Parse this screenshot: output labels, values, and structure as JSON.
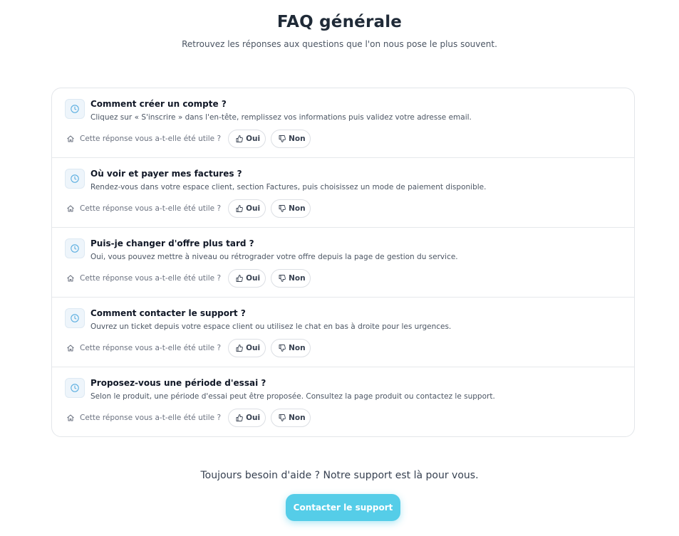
{
  "header": {
    "title": "FAQ générale",
    "subtitle": "Retrouvez les réponses aux questions que l'on nous pose le plus souvent."
  },
  "faq": {
    "feedback_label": "Cette réponse vous a-t-elle été utile ?",
    "yes_label": "Oui",
    "no_label": "Non",
    "items": [
      {
        "question": "Comment créer un compte ?",
        "answer": "Cliquez sur « S'inscrire » dans l'en-tête, remplissez vos informations puis validez votre adresse email."
      },
      {
        "question": "Où voir et payer mes factures ?",
        "answer": "Rendez-vous dans votre espace client, section Factures, puis choisissez un mode de paiement disponible."
      },
      {
        "question": "Puis-je changer d'offre plus tard ?",
        "answer": "Oui, vous pouvez mettre à niveau ou rétrograder votre offre depuis la page de gestion du service."
      },
      {
        "question": "Comment contacter le support ?",
        "answer": "Ouvrez un ticket depuis votre espace client ou utilisez le chat en bas à droite pour les urgences."
      },
      {
        "question": "Proposez-vous une période d'essai ?",
        "answer": "Selon le produit, une période d'essai peut être proposée. Consultez la page produit ou contactez le support."
      }
    ]
  },
  "footer": {
    "help_text": "Toujours besoin d'aide ? Notre support est là pour vous.",
    "support_button_label": "Contacter le support"
  },
  "colors": {
    "accent": "#55cde8",
    "icon_blue": "#5aaee0"
  }
}
